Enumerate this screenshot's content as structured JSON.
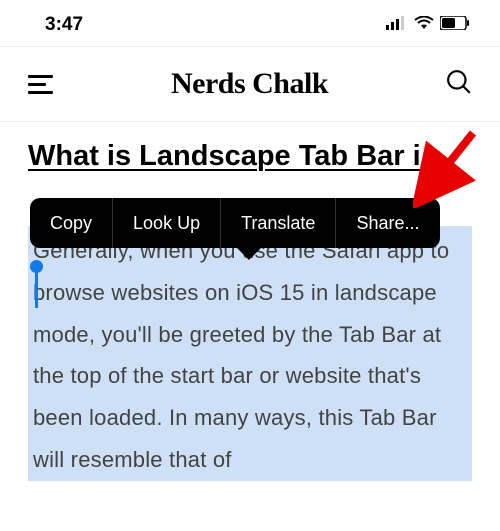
{
  "status_bar": {
    "time": "3:47"
  },
  "header": {
    "site_title": "Nerds Chalk"
  },
  "article": {
    "title": "What is Landscape Tab Bar i",
    "body": "Generally, when you use the Safari app to browse websites on iOS 15 in landscape mode, you'll be greeted by the Tab Bar at the top of the start bar or website that's been loaded. In many ways, this Tab Bar will resemble that of"
  },
  "context_menu": {
    "items": [
      "Copy",
      "Look Up",
      "Translate",
      "Share..."
    ]
  }
}
